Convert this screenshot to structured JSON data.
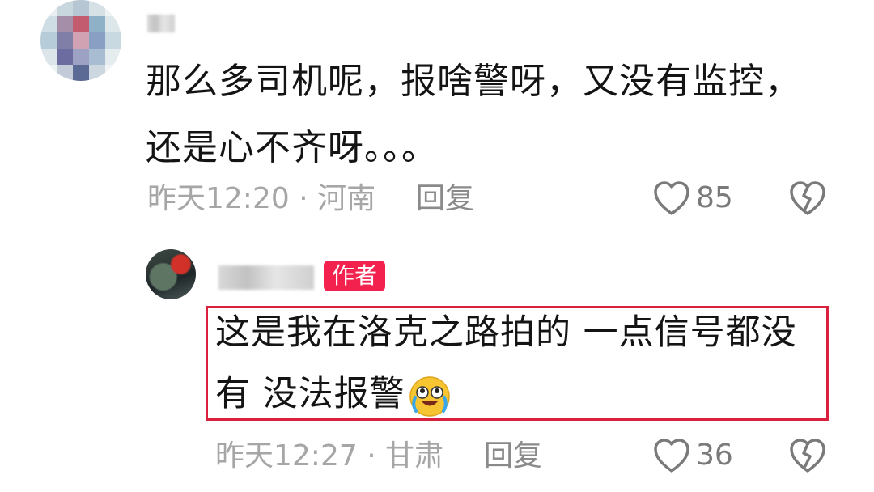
{
  "comment": {
    "text_line1": "那么多司机呢，报啥警呀，又没有监控，",
    "text_line2": "还是心不齐呀。。。",
    "meta": "昨天12:20 · 河南",
    "reply_label": "回复",
    "like_count": "85"
  },
  "reply": {
    "author_badge": "作者",
    "text_line1": "这是我在洛克之路拍的 一点信号都没",
    "text_line2": "有 没法报警",
    "emoji_icon": "crying-laughing-face-icon",
    "meta": "昨天12:27 · 甘肃",
    "reply_label": "回复",
    "like_count": "36"
  },
  "colors": {
    "badge": "#f2214d",
    "highlight_border": "#d9213f",
    "meta_text": "#a6a6a6"
  }
}
